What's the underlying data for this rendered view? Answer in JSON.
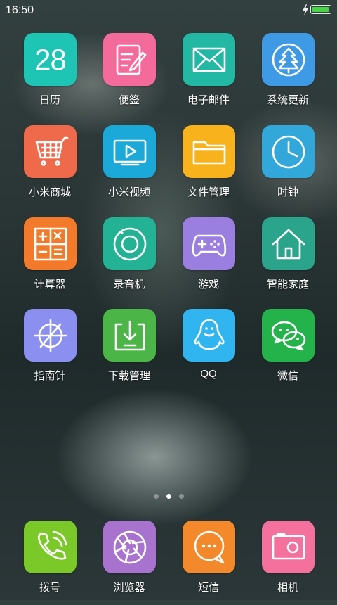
{
  "status": {
    "time": "16:50",
    "battery_level": 1.0,
    "battery_color": "#47d447"
  },
  "apps": [
    {
      "label": "日历",
      "name": "calendar",
      "color": "#1ec5b4",
      "icon": "calendar-icon",
      "date": "28"
    },
    {
      "label": "便签",
      "name": "notes",
      "color": "#f46b9b",
      "icon": "notes-icon"
    },
    {
      "label": "电子邮件",
      "name": "email",
      "color": "#22b8a4",
      "icon": "envelope-icon"
    },
    {
      "label": "系统更新",
      "name": "system-update",
      "color": "#3f9ae6",
      "icon": "tree-icon"
    },
    {
      "label": "小米商城",
      "name": "mi-store",
      "color": "#ee6a4a",
      "icon": "cart-icon"
    },
    {
      "label": "小米视频",
      "name": "mi-video",
      "color": "#1aa9d8",
      "icon": "video-play-icon"
    },
    {
      "label": "文件管理",
      "name": "file-manager",
      "color": "#f7b21c",
      "icon": "folder-icon"
    },
    {
      "label": "时钟",
      "name": "clock",
      "color": "#31a8d9",
      "icon": "clock-icon"
    },
    {
      "label": "计算器",
      "name": "calculator",
      "color": "#f37a2a",
      "icon": "calculator-icon"
    },
    {
      "label": "录音机",
      "name": "recorder",
      "color": "#23b394",
      "icon": "record-icon"
    },
    {
      "label": "游戏",
      "name": "games",
      "color": "#9b7fe0",
      "icon": "gamepad-icon"
    },
    {
      "label": "智能家庭",
      "name": "smart-home",
      "color": "#2aa58c",
      "icon": "house-icon"
    },
    {
      "label": "指南针",
      "name": "compass",
      "color": "#8b8ff0",
      "icon": "compass-icon"
    },
    {
      "label": "下载管理",
      "name": "downloads",
      "color": "#4bb548",
      "icon": "download-icon"
    },
    {
      "label": "QQ",
      "name": "qq",
      "color": "#31b5f0",
      "icon": "penguin-icon"
    },
    {
      "label": "微信",
      "name": "wechat",
      "color": "#24b34a",
      "icon": "wechat-icon"
    }
  ],
  "page_indicator": {
    "count": 3,
    "active": 1
  },
  "dock": [
    {
      "label": "拨号",
      "name": "dialer",
      "color": "#7bc829",
      "icon": "phone-icon"
    },
    {
      "label": "浏览器",
      "name": "browser",
      "color": "#a873cf",
      "icon": "aperture-icon"
    },
    {
      "label": "短信",
      "name": "messages",
      "color": "#f3892a",
      "icon": "chat-bubble-icon"
    },
    {
      "label": "相机",
      "name": "camera",
      "color": "#f4709d",
      "icon": "camera-icon"
    }
  ]
}
